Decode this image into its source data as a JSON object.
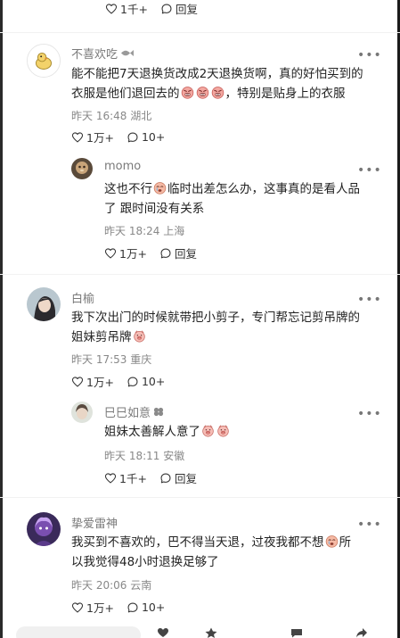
{
  "top_reply": {
    "like_count": "1千+",
    "reply_label": "回复"
  },
  "comments": [
    {
      "user": "不喜欢吃",
      "text_line1": "能不能把7天退换货改成2天退换货啊，真的好怕买到的",
      "text_line2a": "衣服是他们退回去的",
      "text_line2b": "，特别是贴身上的衣服",
      "time": "昨天 16:48",
      "location": "湖北",
      "like_count": "1万+",
      "reply_count": "10+",
      "reply": {
        "user": "momo",
        "text_line1a": "这也不行",
        "text_line1b": "临时出差怎么办，这事真的是看人品",
        "text_line2": "了 跟时间没有关系",
        "time": "昨天 18:24",
        "location": "上海",
        "like_count": "1万+",
        "reply_label": "回复"
      }
    },
    {
      "user": "白榆",
      "text_line1": "我下次出门的时候就带把小剪子，专门帮忘记剪吊牌的",
      "text_line2": "姐妹剪吊牌",
      "time": "昨天 17:53",
      "location": "重庆",
      "like_count": "1万+",
      "reply_count": "10+",
      "reply": {
        "user": "巳巳如意",
        "text": "姐妹太善解人意了",
        "time": "昨天 18:11",
        "location": "安徽",
        "like_count": "1千+",
        "reply_label": "回复"
      }
    },
    {
      "user": "挚爱雷神",
      "text_line1a": "我买到不喜欢的，巴不得当天退，过夜我都不想",
      "text_line1b": "所",
      "text_line2": "以我觉得48小时退换足够了",
      "time": "昨天 20:06",
      "location": "云南",
      "like_count": "1万+",
      "reply_count": "10+"
    }
  ],
  "icons": {
    "like": "heart-outline-icon",
    "comment": "speech-bubble-icon",
    "more": "more-dots-icon",
    "emoji_angry": "angry-face-emoji",
    "emoji_cry": "crying-face-emoji",
    "emoji_pig": "pig-face-emoji"
  },
  "colors": {
    "text": "#222222",
    "muted": "#888888",
    "name": "#7a7a7a"
  }
}
